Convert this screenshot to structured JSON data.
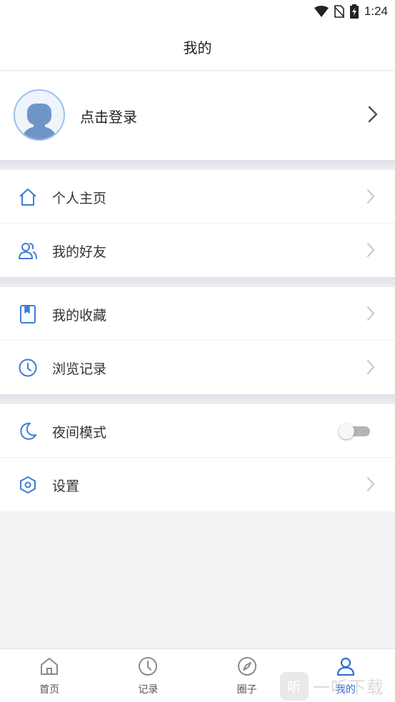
{
  "status_bar": {
    "time": "1:24"
  },
  "header": {
    "title": "我的"
  },
  "profile": {
    "login_label": "点击登录"
  },
  "groups": [
    {
      "items": [
        {
          "label": "个人主页",
          "icon": "home-icon"
        },
        {
          "label": "我的好友",
          "icon": "friends-icon"
        }
      ]
    },
    {
      "items": [
        {
          "label": "我的收藏",
          "icon": "bookmark-icon"
        },
        {
          "label": "浏览记录",
          "icon": "clock-icon"
        }
      ]
    },
    {
      "items": [
        {
          "label": "夜间模式",
          "icon": "moon-icon",
          "toggle_on": false
        },
        {
          "label": "设置",
          "icon": "hexagon-settings-icon"
        }
      ]
    }
  ],
  "tabs": [
    {
      "label": "首页",
      "icon": "home-icon",
      "active": false
    },
    {
      "label": "记录",
      "icon": "clock-icon",
      "active": false
    },
    {
      "label": "圈子",
      "icon": "compass-icon",
      "active": false
    },
    {
      "label": "我的",
      "icon": "user-icon",
      "active": true
    }
  ],
  "watermark": {
    "badge": "听",
    "text": "一听下载"
  },
  "colors": {
    "accent": "#2e6fd8",
    "icon_blue": "#3d7ddb",
    "background": "#f2f3f5"
  }
}
